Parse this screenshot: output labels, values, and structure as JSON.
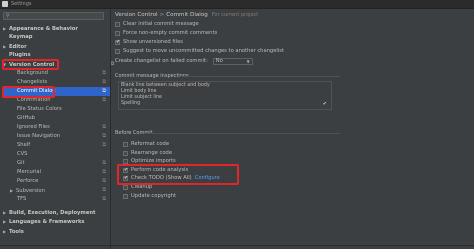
{
  "window": {
    "title": "Settings"
  },
  "breadcrumb": {
    "part1": "Version Control",
    "separator": ">",
    "part2": "Commit Dialog",
    "project": "For current project"
  },
  "sidebar": {
    "items": [
      {
        "label": "Appearance & Behavior",
        "expanded": false
      },
      {
        "label": "Keymap"
      },
      {
        "label": "Editor",
        "expanded": false
      },
      {
        "label": "Plugins"
      },
      {
        "label": "Version Control",
        "expanded": true
      },
      {
        "label": "Background"
      },
      {
        "label": "Changelists"
      },
      {
        "label": "Commit Dialog"
      },
      {
        "label": "Confirmation"
      },
      {
        "label": "File Status Colors"
      },
      {
        "label": "GitHub"
      },
      {
        "label": "Ignored Files"
      },
      {
        "label": "Issue Navigation"
      },
      {
        "label": "Shelf"
      },
      {
        "label": "CVS"
      },
      {
        "label": "Git"
      },
      {
        "label": "Mercurial"
      },
      {
        "label": "Perforce"
      },
      {
        "label": "Subversion",
        "expanded": false
      },
      {
        "label": "TFS"
      },
      {
        "label": "Build, Execution, Deployment",
        "expanded": false
      },
      {
        "label": "Languages & Frameworks",
        "expanded": false
      },
      {
        "label": "Tools",
        "expanded": false
      }
    ]
  },
  "general": {
    "clear_initial": "Clear initial commit message",
    "force_non_empty": "Force non-empty commit comments",
    "show_unversioned": "Show unversioned files",
    "suggest_move": "Suggest to move uncommitted changes to another changelist",
    "create_changelist_label": "Create changelist on failed commit:",
    "create_changelist_value": "No"
  },
  "message_inspections": {
    "title": "Commit message inspections",
    "items": [
      "Blank line between subject and body",
      "Limit body line",
      "Limit subject line",
      "Spelling"
    ],
    "checked": [
      false,
      false,
      false,
      true
    ]
  },
  "before_commit": {
    "title": "Before Commit",
    "reformat": "Reformat code",
    "rearrange": "Rearrange code",
    "optimize": "Optimize imports",
    "perform_analysis": "Perform code analysis",
    "check_todo": "Check TODO (Show All)",
    "configure_link": "Configure",
    "cleanup": "Cleanup",
    "update_copyright": "Update copyright"
  },
  "colors": {
    "selection": "#2f65ca",
    "highlight": "#e0262a",
    "link": "#589df6"
  }
}
